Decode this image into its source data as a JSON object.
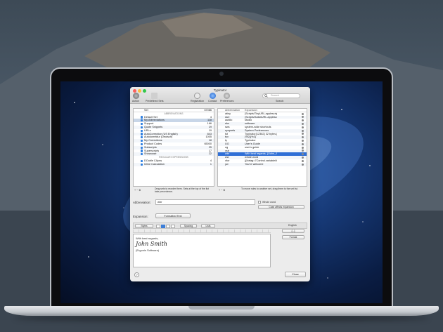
{
  "window": {
    "title": "Typinator",
    "toolbar": {
      "action": "Action",
      "predefined_sets": "Predefined Sets",
      "registration": "Registration",
      "contact": "Contact",
      "preferences": "Preferences",
      "search_placeholder": "Search",
      "search_label": "Search"
    },
    "sets_panel": {
      "header_name": "Set",
      "header_count": "67086",
      "section_abbreviations": "ABBREVIATIONS",
      "sets": [
        {
          "name": "Default Set",
          "count": "4"
        },
        {
          "name": "My Abbreviations",
          "count": "118"
        },
        {
          "name": "Support",
          "count": "166"
        },
        {
          "name": "Quote Snippets",
          "count": "19"
        },
        {
          "name": "URLs",
          "count": "19"
        },
        {
          "name": "AutoCorrection (US English)",
          "count": "843"
        },
        {
          "name": "Autokorrektur (Deutsch)",
          "count": "1005"
        },
        {
          "name": "My Corrections",
          "count": "18"
        },
        {
          "name": "Product Codes",
          "count": "65000"
        },
        {
          "name": "Subscripts",
          "count": "25"
        },
        {
          "name": "Superscripts",
          "count": "17"
        },
        {
          "name": "Showcase",
          "count": "22"
        }
      ],
      "section_regex": "REGULAR EXPRESSIONS",
      "regex_sets": [
        {
          "name": "DOuble CApss",
          "count": "4"
        },
        {
          "name": "Inline Calculation",
          "count": "1"
        }
      ],
      "hint": "Drag sets to reorder them. Sets at the top of the list take precedence."
    },
    "items_panel": {
      "col_abbreviation": "Abbreviation",
      "col_expansion": "Expansion",
      "items": [
        {
          "abbr": "atiny",
          "exp": "{Scripts/TinyURL.applescript {Safar..."
        },
        {
          "abbr": "durl",
          "exp": "{Scripts/SafariURL.applescript}"
        },
        {
          "abbr": "autdio",
          "exp": "studio"
        },
        {
          "abbr": "sfw",
          "exp": "software"
        },
        {
          "abbr": "sws",
          "exp": "system-wide shortcuts"
        },
        {
          "abbr": "sysprefs",
          "exp": "System Preferences"
        },
        {
          "abbr": "tst",
          "exp": "Typinator{12362}   32 bytes {?}"
        },
        {
          "abbr": "tsv",
          "exp": "{%2}{%3}"
        },
        {
          "abbr": "ty",
          "exp": "Typinator"
        },
        {
          "abbr": "UG",
          "exp": "User's Guide"
        },
        {
          "abbr": "ug",
          "exp": "user's guide"
        },
        {
          "abbr": "vsb",
          "exp": ""
        },
        {
          "abbr": "wbr",
          "exp": "With best regards, {Uohn_Smith}"
        },
        {
          "abbr": "ww",
          "exp": "whole word"
        },
        {
          "abbr": "xfor",
          "exp": "{{fortag=7Control.variable/fortfe.txt}"
        },
        {
          "abbr": "yw",
          "exp": "You're welcome"
        }
      ],
      "hint": "To move rules to another set, drag them to the set list."
    },
    "editor": {
      "abbreviation_label": "Abbreviation:",
      "abbreviation_value": "wbr",
      "whole_word": "Whole word",
      "case_option": "Case affects expansion",
      "expansion_label": "Expansion:",
      "expansion_type": "Formatted Text",
      "styles": "Styles",
      "spacing": "Spacing",
      "lists": "Lists",
      "language": "English",
      "format_menu": "Format",
      "text_line1": "With best regards,",
      "text_line2": "John Smith",
      "text_line3": "(Ergonis Software)",
      "help": "?",
      "close": "Close"
    }
  }
}
